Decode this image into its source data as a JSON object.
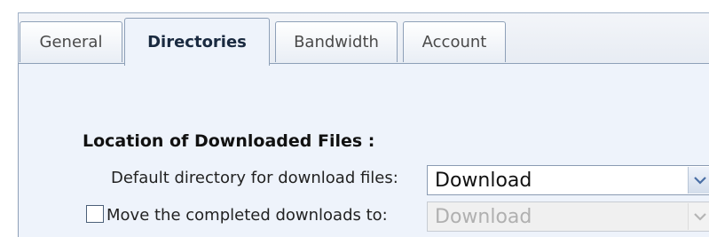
{
  "tabs": [
    {
      "label": "General",
      "active": false
    },
    {
      "label": "Directories",
      "active": true
    },
    {
      "label": "Bandwidth",
      "active": false
    },
    {
      "label": "Account",
      "active": false
    }
  ],
  "section": {
    "title": "Location of Downloaded Files :"
  },
  "default_dir": {
    "label": "Default directory for download files:",
    "value": "Download",
    "enabled": true
  },
  "move_completed": {
    "label": "Move the completed downloads to:",
    "checked": false,
    "value": "Download",
    "enabled": false
  },
  "colors": {
    "panel_bg": "#eef3fb",
    "tab_border": "#8ea0b8",
    "arrow_enabled": "#4a6fa5",
    "arrow_disabled": "#b5b5b5"
  },
  "icons": {
    "dropdown": "chevron-down-icon"
  }
}
